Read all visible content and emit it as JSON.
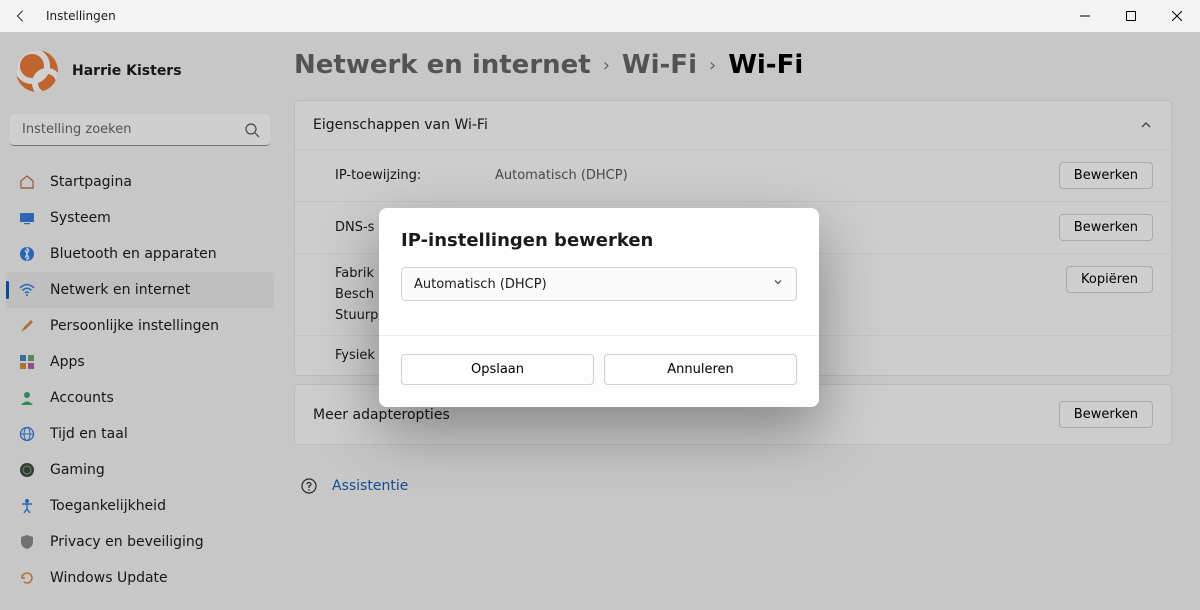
{
  "window": {
    "title": "Instellingen"
  },
  "user": {
    "name": "Harrie Kisters"
  },
  "search": {
    "placeholder": "Instelling zoeken"
  },
  "sidebar": {
    "items": [
      {
        "label": "Startpagina"
      },
      {
        "label": "Systeem"
      },
      {
        "label": "Bluetooth en apparaten"
      },
      {
        "label": "Netwerk en internet"
      },
      {
        "label": "Persoonlijke instellingen"
      },
      {
        "label": "Apps"
      },
      {
        "label": "Accounts"
      },
      {
        "label": "Tijd en taal"
      },
      {
        "label": "Gaming"
      },
      {
        "label": "Toegankelijkheid"
      },
      {
        "label": "Privacy en beveiliging"
      },
      {
        "label": "Windows Update"
      }
    ]
  },
  "breadcrumb": {
    "part1": "Netwerk en internet",
    "part2": "Wi-Fi",
    "current": "Wi-Fi"
  },
  "card": {
    "title": "Eigenschappen van Wi-Fi",
    "rows": {
      "ip_label": "IP-toewijzing:",
      "ip_value": "Automatisch (DHCP)",
      "dns_label_clipped": "DNS-s",
      "manufacturer_clipped": "Fabrik",
      "description_clipped": "Besch",
      "driver_clipped": "Stuurp",
      "physical_clipped": "Fysiek"
    },
    "buttons": {
      "edit": "Bewerken",
      "copy": "Kopiëren"
    }
  },
  "adapter": {
    "label": "Meer adapteropties",
    "button": "Bewerken"
  },
  "help": {
    "label": "Assistentie"
  },
  "modal": {
    "title": "IP-instellingen bewerken",
    "select_value": "Automatisch (DHCP)",
    "save": "Opslaan",
    "cancel": "Annuleren"
  }
}
